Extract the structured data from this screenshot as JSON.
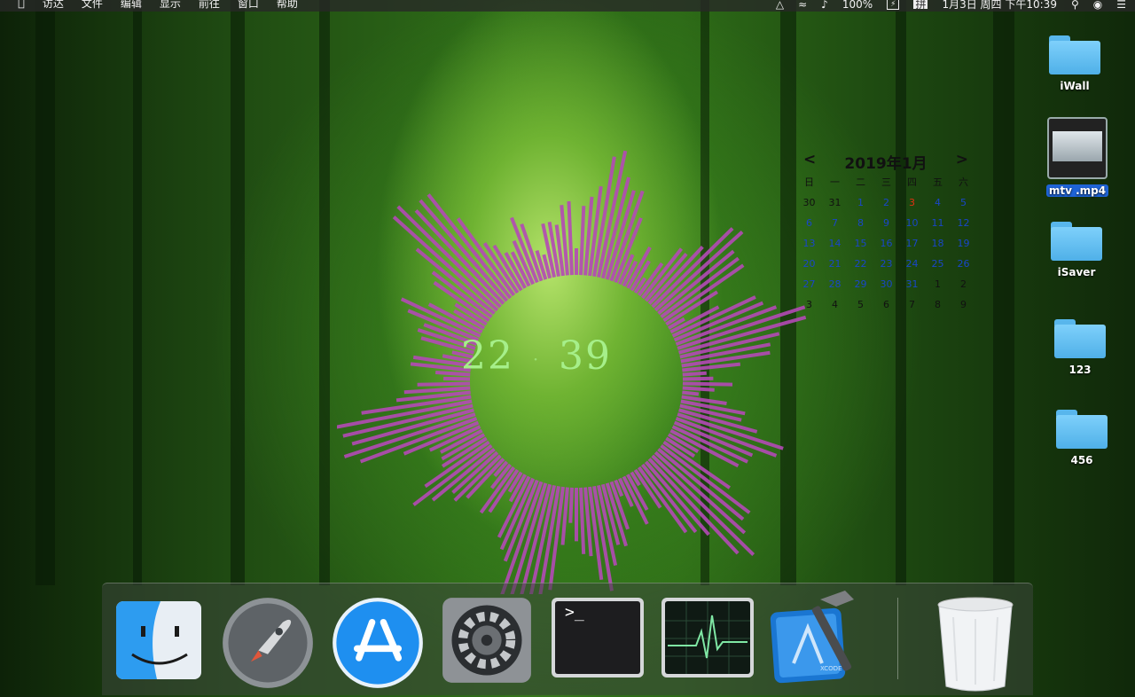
{
  "menubar": {
    "apple_icon": "apple-icon",
    "items": [
      "访达",
      "文件",
      "编辑",
      "显示",
      "前往",
      "窗口",
      "帮助"
    ],
    "status": {
      "battery_percent": "100%",
      "input_method": "拼",
      "datetime": "1月3日 周四 下午10:39"
    }
  },
  "desktop": {
    "items": [
      {
        "label": "iWall",
        "kind": "folder"
      },
      {
        "label": "mtv .mp4",
        "kind": "video"
      },
      {
        "label": "iSaver",
        "kind": "folder"
      },
      {
        "label": "123",
        "kind": "folder"
      },
      {
        "label": "456",
        "kind": "folder"
      }
    ]
  },
  "calendar": {
    "prev": "<",
    "title": "2019年1月",
    "next": ">",
    "weekdays": [
      "日",
      "一",
      "二",
      "三",
      "四",
      "五",
      "六"
    ],
    "weeks": [
      [
        "30",
        "31",
        "1",
        "2",
        "3",
        "4",
        "5"
      ],
      [
        "6",
        "7",
        "8",
        "9",
        "10",
        "11",
        "12"
      ],
      [
        "13",
        "14",
        "15",
        "16",
        "17",
        "18",
        "19"
      ],
      [
        "20",
        "21",
        "22",
        "23",
        "24",
        "25",
        "26"
      ],
      [
        "27",
        "28",
        "29",
        "30",
        "31",
        "1",
        "2"
      ],
      [
        "3",
        "4",
        "5",
        "6",
        "7",
        "8",
        "9"
      ]
    ],
    "today": "3",
    "colors": {
      "current_month": "#1946c8",
      "today": "#e03010",
      "other_month": "#111111"
    }
  },
  "clock": {
    "hours": "22",
    "minutes": "39"
  },
  "visualizer": {
    "color": "#b44ab6"
  },
  "dock": {
    "apps": [
      {
        "name": "Finder",
        "icon": "finder-icon"
      },
      {
        "name": "Launchpad",
        "icon": "launchpad-icon"
      },
      {
        "name": "App Store",
        "icon": "app-store-icon"
      },
      {
        "name": "System Preferences",
        "icon": "system-preferences-icon"
      },
      {
        "name": "Terminal",
        "icon": "terminal-icon"
      },
      {
        "name": "Activity Monitor",
        "icon": "activity-monitor-icon"
      },
      {
        "name": "Xcode",
        "icon": "xcode-icon"
      },
      {
        "name": "Trash",
        "icon": "trash-icon"
      }
    ],
    "terminal_prompt": ">_",
    "xcode_badge": "XCODE"
  }
}
